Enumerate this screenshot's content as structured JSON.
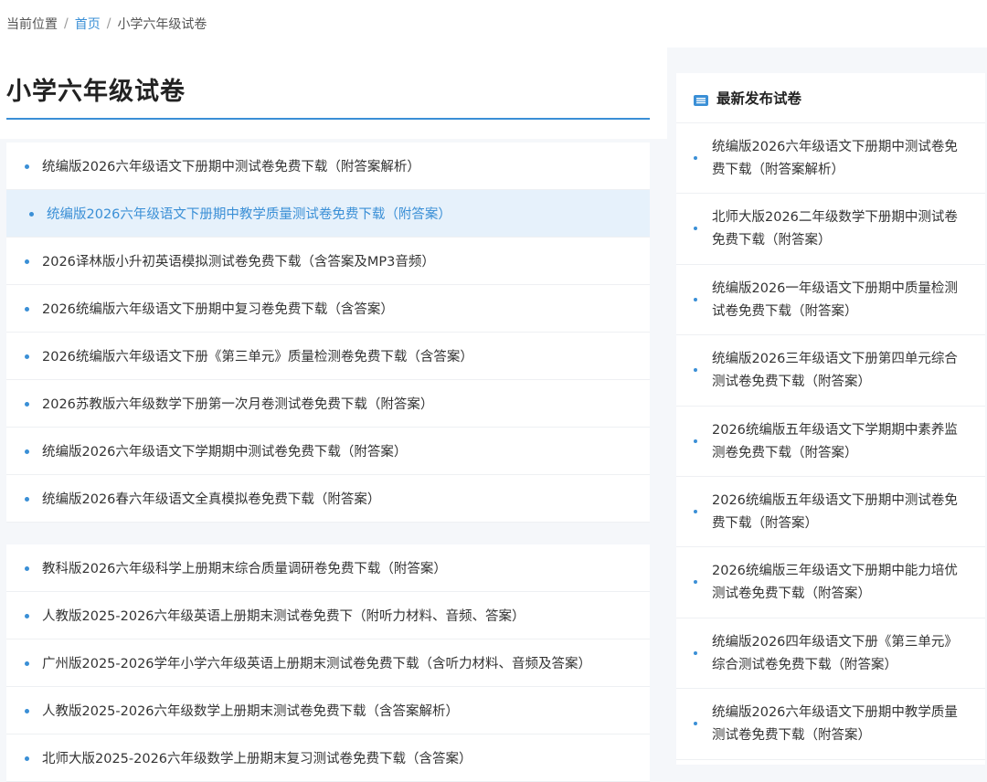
{
  "breadcrumb": {
    "prefix": "当前位置",
    "separator": "/",
    "home": "首页",
    "current": "小学六年级试卷"
  },
  "page": {
    "title": "小学六年级试卷"
  },
  "main_list_group1": [
    "统编版2026六年级语文下册期中测试卷免费下载（附答案解析）",
    "统编版2026六年级语文下册期中教学质量测试卷免费下载（附答案）",
    "2026译林版小升初英语模拟测试卷免费下载（含答案及MP3音频）",
    "2026统编版六年级语文下册期中复习卷免费下载（含答案）",
    "2026统编版六年级语文下册《第三单元》质量检测卷免费下载（含答案）",
    "2026苏教版六年级数学下册第一次月卷测试卷免费下载（附答案）",
    "统编版2026六年级语文下学期期中测试卷免费下载（附答案）",
    "统编版2026春六年级语文全真模拟卷免费下载（附答案）"
  ],
  "main_list_group2": [
    "教科版2026六年级科学上册期末综合质量调研卷免费下载（附答案）",
    "人教版2025-2026六年级英语上册期末测试卷免费下（附听力材料、音频、答案）",
    "广州版2025-2026学年小学六年级英语上册期末测试卷免费下载（含听力材料、音频及答案）",
    "人教版2025-2026六年级数学上册期末测试卷免费下载（含答案解析）",
    "北师大版2025-2026六年级数学上册期末复习测试卷免费下载（含答案）"
  ],
  "active_item": "统编版2026六年级语文下册期中教学质量测试卷免费下载（附答案）",
  "sidebar": {
    "title": "最新发布试卷",
    "icon": "list-icon",
    "items": [
      "统编版2026六年级语文下册期中测试卷免费下载（附答案解析）",
      "北师大版2026二年级数学下册期中测试卷免费下载（附答案）",
      "统编版2026一年级语文下册期中质量检测试卷免费下载（附答案）",
      "统编版2026三年级语文下册第四单元综合测试卷免费下载（附答案）",
      "2026统编版五年级语文下学期期中素养监测卷免费下载（附答案）",
      "2026统编版五年级语文下册期中测试卷免费下载（附答案）",
      "2026统编版三年级语文下册期中能力培优测试卷免费下载（附答案）",
      "统编版2026四年级语文下册《第三单元》综合测试卷免费下载（附答案）",
      "统编版2026六年级语文下册期中教学质量测试卷免费下载（附答案）"
    ]
  },
  "colors": {
    "accent": "#3a8fd6",
    "active_bg": "#e6f1fb",
    "page_bg": "#f5f7fa"
  }
}
